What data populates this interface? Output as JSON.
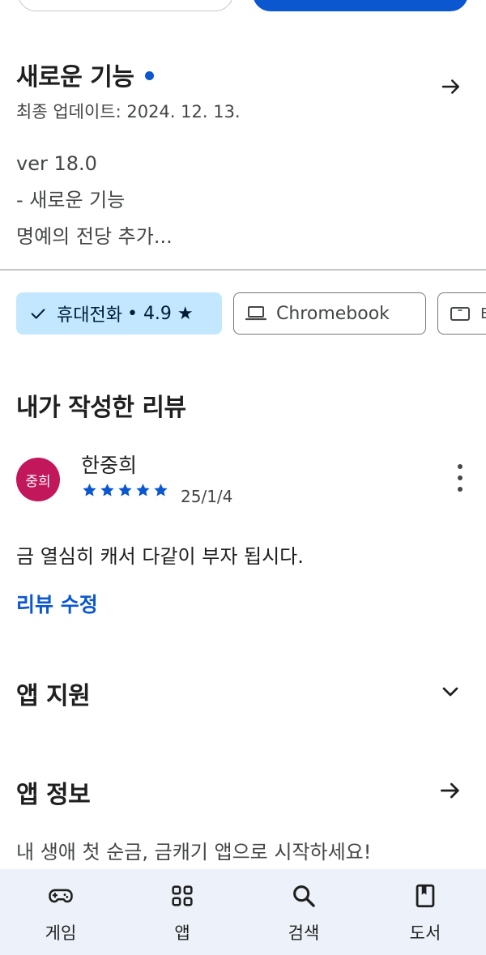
{
  "whats_new": {
    "title": "새로운 기능",
    "last_updated": "최종 업데이트: 2024. 12. 13.",
    "lines": [
      "ver 18.0",
      "- 새로운 기능",
      "명예의 전당 추가..."
    ]
  },
  "device_chips": [
    {
      "label": "휴대전화",
      "rating": "• 4.9 ★",
      "selected": true
    },
    {
      "label": "Chromebook",
      "selected": false
    },
    {
      "label": "태",
      "selected": false
    }
  ],
  "my_review": {
    "section_title": "내가 작성한 리뷰",
    "avatar_text": "중희",
    "reviewer_name": "한중희",
    "stars": 5,
    "date": "25/1/4",
    "text": "금 열심히 캐서 다같이 부자 됩시다.",
    "edit_label": "리뷰 수정"
  },
  "app_support": {
    "title": "앱 지원"
  },
  "app_info": {
    "title": "앱 정보",
    "description": "내 생애 첫 순금, 금캐기 앱으로 시작하세요!"
  },
  "bottom_nav": [
    {
      "label": "게임",
      "icon": "gamepad-icon"
    },
    {
      "label": "앱",
      "icon": "apps-grid-icon"
    },
    {
      "label": "검색",
      "icon": "search-icon"
    },
    {
      "label": "도서",
      "icon": "book-icon"
    }
  ],
  "colors": {
    "accent": "#0b57d0",
    "chip_selected_bg": "#c2e7ff",
    "avatar_bg": "#c2185b",
    "nav_bg": "#edf2fa"
  }
}
